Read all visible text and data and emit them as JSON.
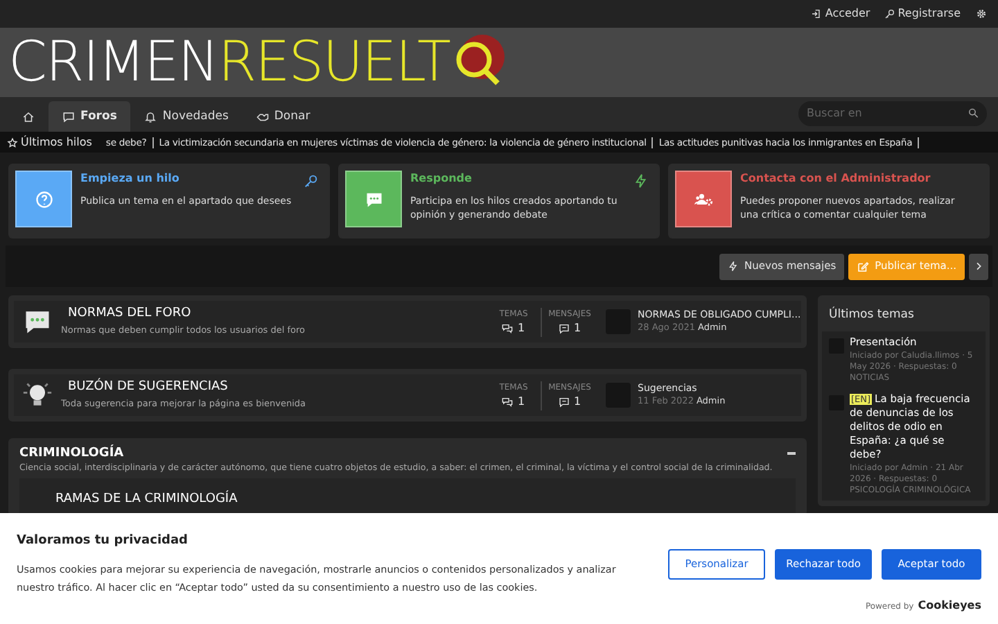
{
  "top_bar": {
    "links": [
      {
        "label": "Acceder"
      },
      {
        "label": "Registrarse"
      }
    ]
  },
  "logo": {
    "part_1": "CRIMEN",
    "part_2": "RESUELT"
  },
  "nav": {
    "tabs": [
      {
        "kind": "home",
        "selected": false
      },
      {
        "label": "Foros",
        "kind": "forums",
        "selected": true
      },
      {
        "label": "Novedades",
        "kind": "news",
        "selected": false
      },
      {
        "label": "Donar",
        "kind": "donate",
        "selected": false
      }
    ],
    "search": {
      "placeholder": "Buscar en"
    }
  },
  "ticker": {
    "label": "Últimos hilos",
    "items": [
      "se debe?",
      "La victimización secundaria en mujeres víctimas de violencia de género: la violencia de género institucional",
      "Las actitudes punitivas hacia los inmigrantes en España"
    ]
  },
  "feature_cards": [
    {
      "title": "Empieza un hilo",
      "text": "Publica un tema en el apartado que desees",
      "color": "#5aa9f5",
      "kind": "question"
    },
    {
      "title": "Responde",
      "text": "Participa en los hilos creados aportando tu opinión y generando debate",
      "color": "#5cb85c",
      "kind": "chat"
    },
    {
      "title": "Contacta con el Administrador",
      "text": "Puedes proponer nuevos apartados, realizar una crítica o comentar cualquier tema",
      "color": "#d9534f",
      "kind": "users"
    }
  ],
  "actions": {
    "new_posts": "Nuevos mensajes",
    "post_thread": "Publicar tema..."
  },
  "forums": [
    {
      "title": "NORMAS DEL FORO",
      "description": "Normas que deben cumplir todos los usuarios del foro",
      "kind": "chat",
      "threads_label": "TEMAS",
      "threads": "1",
      "messages_label": "MENSAJES",
      "messages": "1",
      "last_title": "NORMAS DE OBLIGADO CUMPLI...",
      "last_date": "28 Ago 2021",
      "last_user": "Admin"
    },
    {
      "title": "BUZÓN DE SUGERENCIAS",
      "description": "Toda sugerencia para mejorar la página es bienvenida",
      "kind": "bulb",
      "threads_label": "TEMAS",
      "threads": "1",
      "messages_label": "MENSAJES",
      "messages": "1",
      "last_title": "Sugerencias",
      "last_date": "11 Feb 2022",
      "last_user": "Admin"
    }
  ],
  "category": {
    "title": "CRIMINOLOGÍA",
    "description": "Ciencia social, interdisciplinaria y de carácter autónomo, que tiene cuatro objetos de estudio, a saber: el crimen, el criminal, la víctima y el control social de la criminalidad.",
    "expanded": true,
    "subforum": "RAMAS DE LA CRIMINOLOGÍA"
  },
  "sidebar": {
    "title": "Últimos temas",
    "threads": [
      {
        "title": "Presentación",
        "meta": "Iniciado por Caludia.llimos · 5 May 2026 · Respuestas: 0",
        "forum": "NOTICIAS"
      },
      {
        "prefix": "[EN]",
        "title": "La baja frecuencia de denuncias de los delitos de odio en España: ¿a qué se debe?",
        "meta": "Iniciado por Admin · 21 Abr 2026 · Respuestas: 0",
        "forum": "PSICOLOGÍA CRIMINOLÓGICA"
      }
    ]
  },
  "cookie_banner": {
    "title": "Valoramos tu privacidad",
    "text": "Usamos cookies para mejorar su experiencia de navegación, mostrarle anuncios o contenidos personalizados y analizar nuestro tráfico. Al hacer clic en “Aceptar todo” usted da su consentimiento a nuestro uso de las cookies.",
    "buttons": [
      {
        "label": "Personalizar",
        "kind": "outline"
      },
      {
        "label": "Rechazar todo",
        "kind": "solid"
      },
      {
        "label": "Aceptar todo",
        "kind": "solid"
      }
    ],
    "powered_by": "Powered by",
    "brand": "Cookieyes"
  }
}
